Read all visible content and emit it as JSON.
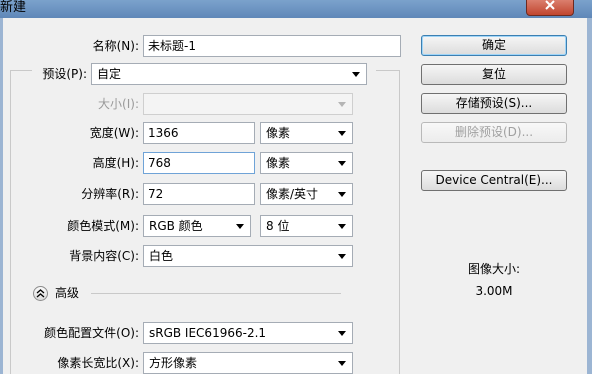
{
  "window": {
    "title": "新建"
  },
  "form": {
    "name": {
      "label": "名称(N):",
      "value": "未标题-1"
    },
    "preset": {
      "label": "预设(P):",
      "value": "自定"
    },
    "size": {
      "label": "大小(I):",
      "value": ""
    },
    "width": {
      "label": "宽度(W):",
      "value": "1366",
      "unit": "像素"
    },
    "height": {
      "label": "高度(H):",
      "value": "768",
      "unit": "像素"
    },
    "resolution": {
      "label": "分辨率(R):",
      "value": "72",
      "unit": "像素/英寸"
    },
    "color_mode": {
      "label": "颜色模式(M):",
      "value": "RGB 颜色",
      "depth": "8 位"
    },
    "background": {
      "label": "背景内容(C):",
      "value": "白色"
    },
    "advanced": {
      "label": "高级"
    },
    "color_profile": {
      "label": "颜色配置文件(O):",
      "value": "sRGB IEC61966-2.1"
    },
    "pixel_aspect": {
      "label": "像素长宽比(X):",
      "value": "方形像素"
    }
  },
  "buttons": {
    "ok": "确定",
    "reset": "复位",
    "save_preset": "存储预设(S)...",
    "delete_preset": "删除预设(D)...",
    "device_central": "Device Central(E)..."
  },
  "image_size": {
    "label": "图像大小:",
    "value": "3.00M"
  },
  "colors": {
    "titlebar": "#6f96c4",
    "close": "#c9503a",
    "default_button_border": "#3c7fb1"
  }
}
